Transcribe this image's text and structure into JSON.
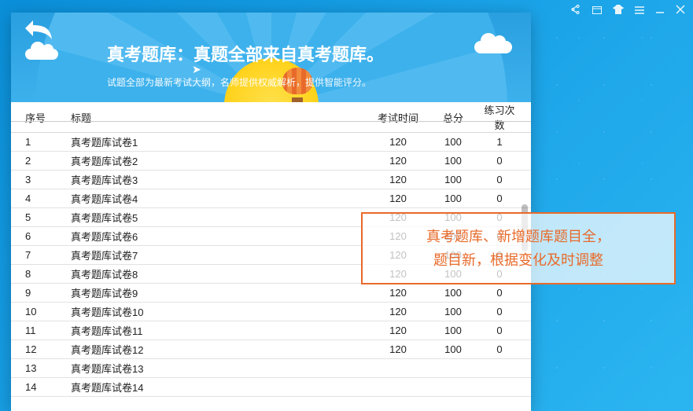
{
  "hero": {
    "title": "真考题库：真题全部来自真考题库。",
    "subtitle": "试题全部为最新考试大纲，名师提供权威解析，提供智能评分。"
  },
  "columns": {
    "seq": "序号",
    "title": "标题",
    "time": "考试时间",
    "score": "总分",
    "attempts": "练习次数"
  },
  "rows": [
    {
      "seq": "1",
      "title": "真考题库试卷1",
      "time": "120",
      "score": "100",
      "attempts": "1"
    },
    {
      "seq": "2",
      "title": "真考题库试卷2",
      "time": "120",
      "score": "100",
      "attempts": "0"
    },
    {
      "seq": "3",
      "title": "真考题库试卷3",
      "time": "120",
      "score": "100",
      "attempts": "0"
    },
    {
      "seq": "4",
      "title": "真考题库试卷4",
      "time": "120",
      "score": "100",
      "attempts": "0"
    },
    {
      "seq": "5",
      "title": "真考题库试卷5",
      "time": "120",
      "score": "100",
      "attempts": "0"
    },
    {
      "seq": "6",
      "title": "真考题库试卷6",
      "time": "120",
      "score": "100",
      "attempts": "0"
    },
    {
      "seq": "7",
      "title": "真考题库试卷7",
      "time": "120",
      "score": "100",
      "attempts": "0"
    },
    {
      "seq": "8",
      "title": "真考题库试卷8",
      "time": "120",
      "score": "100",
      "attempts": "0"
    },
    {
      "seq": "9",
      "title": "真考题库试卷9",
      "time": "120",
      "score": "100",
      "attempts": "0"
    },
    {
      "seq": "10",
      "title": "真考题库试卷10",
      "time": "120",
      "score": "100",
      "attempts": "0"
    },
    {
      "seq": "11",
      "title": "真考题库试卷11",
      "time": "120",
      "score": "100",
      "attempts": "0"
    },
    {
      "seq": "12",
      "title": "真考题库试卷12",
      "time": "120",
      "score": "100",
      "attempts": "0"
    },
    {
      "seq": "13",
      "title": "真考题库试卷13",
      "time": "",
      "score": "",
      "attempts": ""
    },
    {
      "seq": "14",
      "title": "真考题库试卷14",
      "time": "",
      "score": "",
      "attempts": ""
    }
  ],
  "callout": {
    "line1": "真考题库、新增题库题目全，",
    "line2": "题目新，根据变化及时调整"
  },
  "toolbar": {
    "share": "share",
    "window": "window",
    "skin": "skin",
    "menu": "menu",
    "minimize": "minimize",
    "close": "close"
  }
}
